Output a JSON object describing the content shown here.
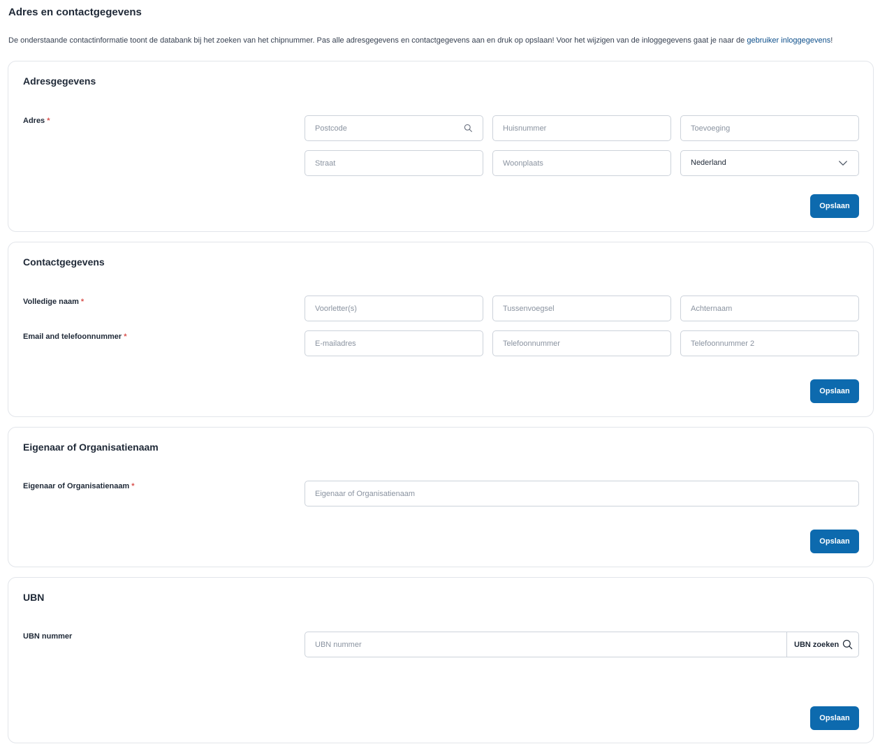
{
  "page": {
    "title": "Adres en contactgegevens",
    "intro_text": "De onderstaande contactinformatie toont de databank bij het zoeken van het chipnummer. Pas alle adresgegevens en contactgegevens aan en druk op opslaan! Voor het wijzigen van de inloggegevens gaat je naar de ",
    "intro_link": "gebruiker inloggegevens",
    "intro_end": "!"
  },
  "address": {
    "title": "Adresgegevens",
    "label": "Adres",
    "required": "*",
    "postcode_placeholder": "Postcode",
    "huisnummer_placeholder": "Huisnummer",
    "toevoeging_placeholder": "Toevoeging",
    "straat_placeholder": "Straat",
    "woonplaats_placeholder": "Woonplaats",
    "country_value": "Nederland",
    "save_label": "Opslaan"
  },
  "contact": {
    "title": "Contactgegevens",
    "name_label": "Volledige naam",
    "email_phone_label": "Email and telefoonnummer",
    "required": "*",
    "voorletters_placeholder": "Voorletter(s)",
    "tussenvoegsel_placeholder": "Tussenvoegsel",
    "achternaam_placeholder": "Achternaam",
    "email_placeholder": "E-mailadres",
    "phone_placeholder": "Telefoonnummer",
    "phone2_placeholder": "Telefoonnummer 2",
    "save_label": "Opslaan"
  },
  "owner": {
    "title": "Eigenaar of Organisatienaam",
    "label": "Eigenaar of Organisatienaam",
    "required": "*",
    "placeholder": "Eigenaar of Organisatienaam",
    "save_label": "Opslaan"
  },
  "ubn": {
    "title": "UBN",
    "label": "UBN nummer",
    "placeholder": "UBN nummer",
    "search_label": "UBN zoeken",
    "save_label": "Opslaan"
  },
  "icons": {
    "search": "search-icon",
    "chevron": "chevron-down-icon"
  },
  "colors": {
    "primary": "#0d6aae",
    "link": "#0d4f8b",
    "required": "#d9534f"
  }
}
